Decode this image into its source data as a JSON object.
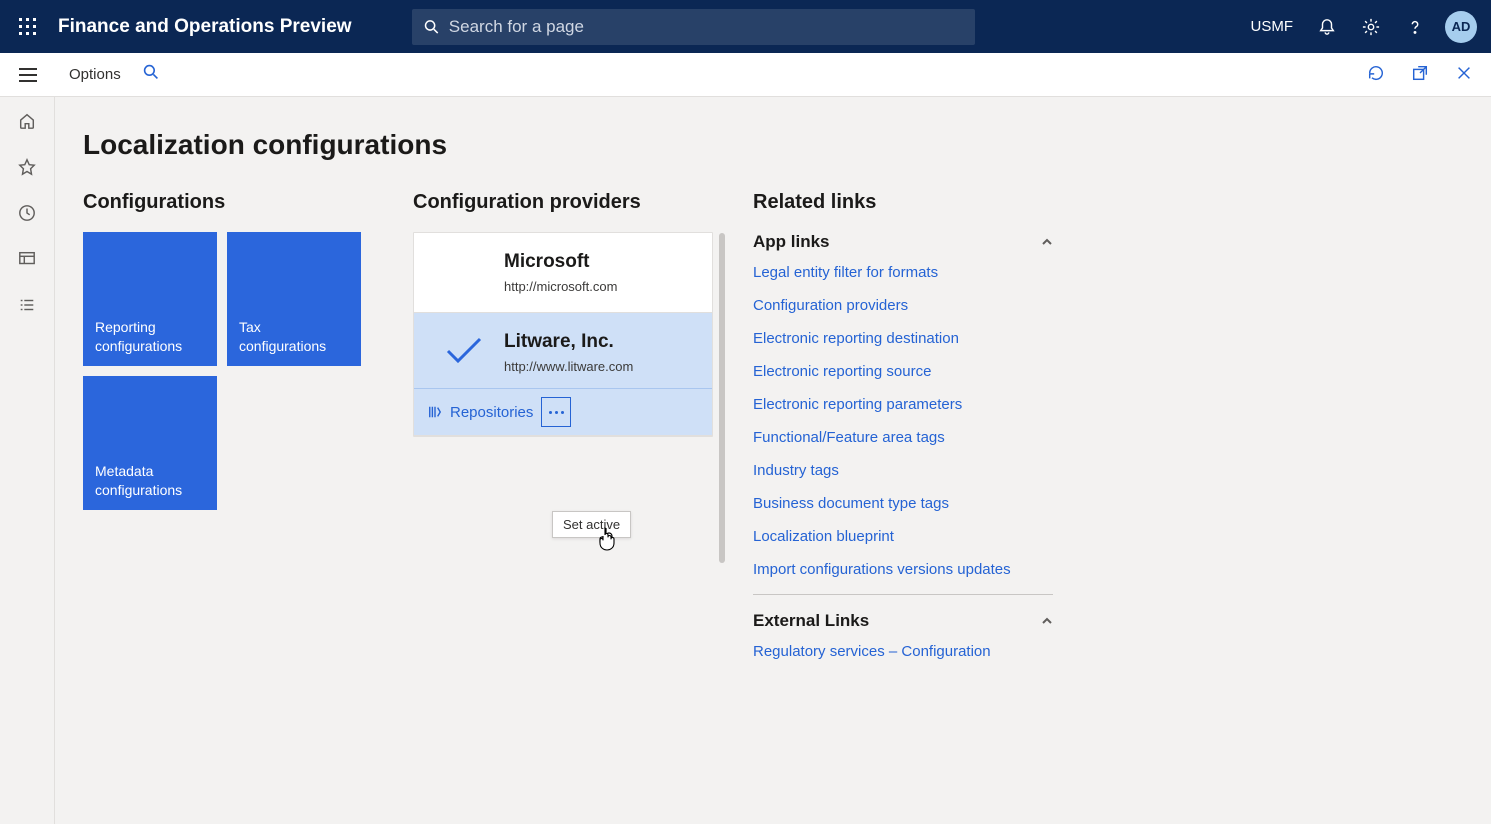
{
  "topbar": {
    "app_title": "Finance and Operations Preview",
    "search_placeholder": "Search for a page",
    "env": "USMF",
    "avatar": "AD"
  },
  "commandbar": {
    "options": "Options"
  },
  "page": {
    "title": "Localization configurations"
  },
  "configurations": {
    "heading": "Configurations",
    "tiles": {
      "reporting": "Reporting configurations",
      "tax": "Tax configurations",
      "metadata": "Metadata configurations"
    }
  },
  "providers": {
    "heading": "Configuration providers",
    "microsoft": {
      "name": "Microsoft",
      "url": "http://microsoft.com"
    },
    "litware": {
      "name": "Litware, Inc.",
      "url": "http://www.litware.com"
    },
    "repositories_label": "Repositories",
    "tooltip": "Set active"
  },
  "related": {
    "heading": "Related links",
    "app_links_heading": "App links",
    "app_links": {
      "legal_entity": "Legal entity filter for formats",
      "config_providers": "Configuration providers",
      "er_destination": "Electronic reporting destination",
      "er_source": "Electronic reporting source",
      "er_parameters": "Electronic reporting parameters",
      "functional_tags": "Functional/Feature area tags",
      "industry_tags": "Industry tags",
      "doc_type_tags": "Business document type tags",
      "localization_blueprint": "Localization blueprint",
      "import_versions": "Import configurations versions updates"
    },
    "external_heading": "External Links",
    "external": {
      "regulatory": "Regulatory services – Configuration"
    }
  }
}
